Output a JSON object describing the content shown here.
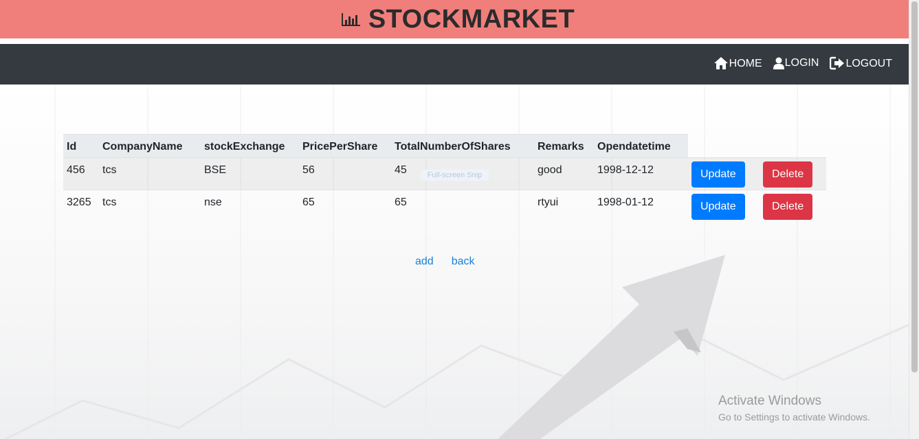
{
  "header": {
    "title": "STOCKMARKET",
    "icon": "bar-chart-icon",
    "color": "#f07f7c"
  },
  "nav": {
    "color": "#343a40",
    "items": [
      {
        "label": "HOME",
        "icon": "home-icon"
      },
      {
        "label": "LOGIN",
        "icon": "user-icon"
      },
      {
        "label": "LOGOUT",
        "icon": "sign-out-icon"
      }
    ]
  },
  "table": {
    "columns": [
      "Id",
      "CompanyName",
      "stockExchange",
      "PricePerShare",
      "TotalNumberOfShares",
      "Remarks",
      "Opendatetime"
    ],
    "rows": [
      {
        "id": "456",
        "company": "tcs",
        "exchange": "BSE",
        "price": "56",
        "shares": "45",
        "remarks": "good",
        "opendate": "1998-12-12",
        "update": "Update",
        "delete": "Delete"
      },
      {
        "id": "3265",
        "company": "tcs",
        "exchange": "nse",
        "price": "65",
        "shares": "65",
        "remarks": "rtyui",
        "opendate": "1998-01-12",
        "update": "Update",
        "delete": "Delete"
      }
    ]
  },
  "links": {
    "add": "add",
    "back": "back"
  },
  "overlay": {
    "snip": "Full-screen Snip"
  },
  "windows_watermark": {
    "title": "Activate Windows",
    "subtitle": "Go to Settings to activate Windows."
  },
  "colors": {
    "update": "#007bff",
    "delete": "#dc3545",
    "link": "#1c7ed6"
  }
}
